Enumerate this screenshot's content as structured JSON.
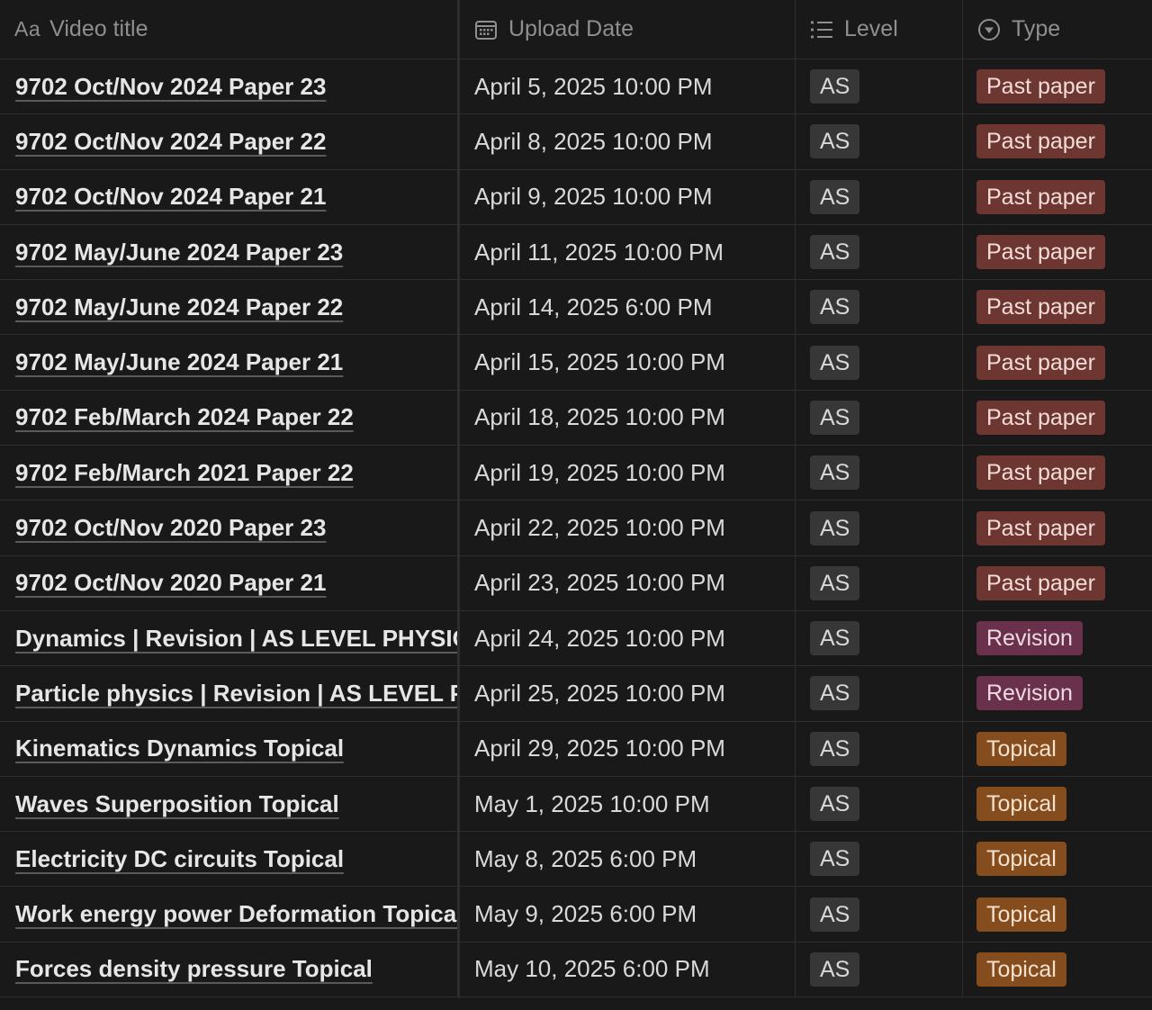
{
  "columns": {
    "title": {
      "icon": "text-property-icon",
      "icon_text": "Aa",
      "label": "Video title"
    },
    "date": {
      "icon": "calendar-icon",
      "label": "Upload Date"
    },
    "level": {
      "icon": "list-icon",
      "label": "Level"
    },
    "type": {
      "icon": "select-icon",
      "label": "Type"
    }
  },
  "colors": {
    "background": "#191919",
    "past_paper": "#6e3630",
    "revision": "#69314c",
    "topical": "#854c1d",
    "level_tag": "#373737"
  },
  "rows": [
    {
      "title": "9702 Oct/Nov 2024 Paper 23",
      "date": "April 5, 2025 10:00 PM",
      "level": "AS",
      "type": "Past paper",
      "type_key": "past"
    },
    {
      "title": "9702 Oct/Nov 2024 Paper 22",
      "date": "April 8, 2025 10:00 PM",
      "level": "AS",
      "type": "Past paper",
      "type_key": "past"
    },
    {
      "title": "9702 Oct/Nov 2024 Paper 21",
      "date": "April 9, 2025 10:00 PM",
      "level": "AS",
      "type": "Past paper",
      "type_key": "past"
    },
    {
      "title": "9702 May/June 2024 Paper 23",
      "date": "April 11, 2025 10:00 PM",
      "level": "AS",
      "type": "Past paper",
      "type_key": "past"
    },
    {
      "title": "9702 May/June 2024 Paper 22",
      "date": "April 14, 2025 6:00 PM",
      "level": "AS",
      "type": "Past paper",
      "type_key": "past"
    },
    {
      "title": "9702 May/June 2024 Paper 21",
      "date": "April 15, 2025 10:00 PM",
      "level": "AS",
      "type": "Past paper",
      "type_key": "past"
    },
    {
      "title": "9702 Feb/March 2024 Paper 22",
      "date": "April 18, 2025 10:00 PM",
      "level": "AS",
      "type": "Past paper",
      "type_key": "past"
    },
    {
      "title": "9702 Feb/March 2021 Paper 22",
      "date": "April 19, 2025 10:00 PM",
      "level": "AS",
      "type": "Past paper",
      "type_key": "past"
    },
    {
      "title": "9702 Oct/Nov 2020 Paper 23",
      "date": "April 22, 2025 10:00 PM",
      "level": "AS",
      "type": "Past paper",
      "type_key": "past"
    },
    {
      "title": "9702 Oct/Nov 2020 Paper 21",
      "date": "April 23, 2025 10:00 PM",
      "level": "AS",
      "type": "Past paper",
      "type_key": "past"
    },
    {
      "title": "Dynamics | Revision | AS LEVEL PHYSICS",
      "date": "April 24, 2025 10:00 PM",
      "level": "AS",
      "type": "Revision",
      "type_key": "revision"
    },
    {
      "title": "Particle physics | Revision | AS LEVEL PH",
      "date": "April 25, 2025 10:00 PM",
      "level": "AS",
      "type": "Revision",
      "type_key": "revision"
    },
    {
      "title": "Kinematics Dynamics Topical",
      "date": "April 29, 2025 10:00 PM",
      "level": "AS",
      "type": "Topical",
      "type_key": "topical"
    },
    {
      "title": "Waves Superposition Topical",
      "date": "May 1, 2025 10:00 PM",
      "level": "AS",
      "type": "Topical",
      "type_key": "topical"
    },
    {
      "title": "Electricity DC circuits Topical",
      "date": "May 8, 2025 6:00 PM",
      "level": "AS",
      "type": "Topical",
      "type_key": "topical"
    },
    {
      "title": "Work energy power Deformation Topical",
      "date": "May 9, 2025 6:00 PM",
      "level": "AS",
      "type": "Topical",
      "type_key": "topical"
    },
    {
      "title": "Forces density pressure Topical",
      "date": "May 10, 2025 6:00 PM",
      "level": "AS",
      "type": "Topical",
      "type_key": "topical"
    }
  ]
}
